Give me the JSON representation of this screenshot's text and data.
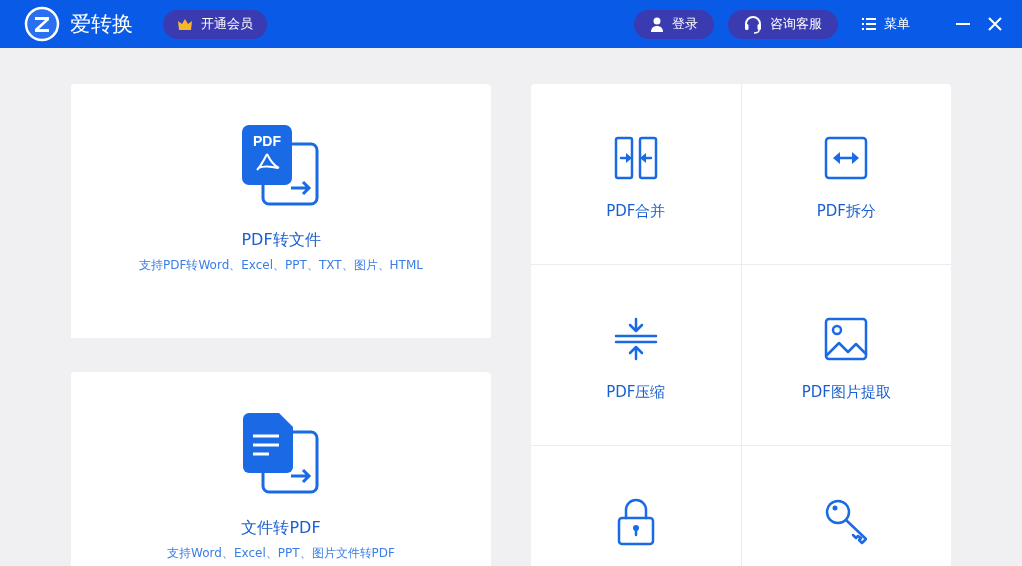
{
  "app": {
    "name": "爱转换",
    "vip_button": "开通会员"
  },
  "header_actions": [
    {
      "kind": "user",
      "label": "登录"
    },
    {
      "kind": "support",
      "label": "咨询客服"
    },
    {
      "kind": "menu",
      "label": "菜单"
    }
  ],
  "window_controls": [
    {
      "kind": "minimize"
    },
    {
      "kind": "close"
    }
  ],
  "feature_cards": [
    {
      "kind": "pdf-to-file",
      "badge": "PDF",
      "title": "PDF转文件",
      "subtitle": "支持PDF转Word、Excel、PPT、TXT、图片、HTML"
    },
    {
      "kind": "file-to-pdf",
      "title": "文件转PDF",
      "subtitle": "支持Word、Excel、PPT、图片文件转PDF"
    }
  ],
  "tools": [
    {
      "kind": "merge",
      "label": "PDF合并"
    },
    {
      "kind": "split",
      "label": "PDF拆分"
    },
    {
      "kind": "compress",
      "label": "PDF压缩"
    },
    {
      "kind": "image",
      "label": "PDF图片提取"
    },
    {
      "kind": "lock"
    },
    {
      "kind": "key"
    }
  ]
}
